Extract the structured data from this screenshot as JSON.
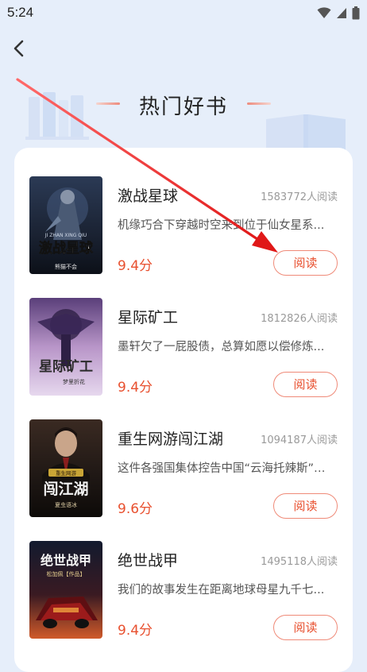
{
  "status_bar": {
    "time": "5:24"
  },
  "header": {
    "title": "热门好书"
  },
  "colors": {
    "accent": "#e8502f",
    "button_border": "#ef8a78",
    "background": "#e6eefa",
    "annotation_arrow": "#e02020"
  },
  "books": [
    {
      "title": "激战星球",
      "readers": "1583772人阅读",
      "description": "机缘巧合下穿越时空来到位于仙女星系...",
      "rating": "9.4分",
      "button": "阅读",
      "cover_text": "激战星球",
      "cover_subtitle": "JI ZHAN XING QIU",
      "cover_author": "熊猫不会"
    },
    {
      "title": "星际矿工",
      "readers": "1812826人阅读",
      "description": "墨轩欠了一屁股债，总算如愿以偿修炼...",
      "rating": "9.4分",
      "button": "阅读",
      "cover_text": "星际矿工",
      "cover_author": "梦里折花"
    },
    {
      "title": "重生网游闯江湖",
      "readers": "1094187人阅读",
      "description": "这件各强国集体控告中国“云海托辣斯”的...",
      "rating": "9.6分",
      "button": "阅读",
      "cover_text": "闯江湖",
      "cover_badge": "重生网游",
      "cover_author": "夏虫语冰"
    },
    {
      "title": "绝世战甲",
      "readers": "1495118人阅读",
      "description": "我们的故事发生在距离地球母星九千七...",
      "rating": "9.4分",
      "button": "阅读",
      "cover_text": "绝世战甲",
      "cover_author": "松加佩【作品】"
    }
  ]
}
